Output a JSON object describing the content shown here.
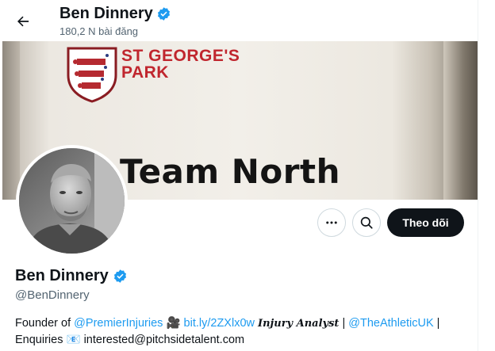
{
  "header": {
    "back_icon": "arrow-left-icon",
    "name": "Ben Dinnery",
    "posts_count": "180,2 N bài đăng"
  },
  "banner": {
    "sign_line1": "ST GEORGE'S",
    "sign_line2": "PARK",
    "sign_main": "Team North"
  },
  "actions": {
    "more_icon": "more-dots-icon",
    "search_icon": "search-icon",
    "follow_label": "Theo dõi"
  },
  "profile": {
    "name": "Ben Dinnery",
    "handle": "@BenDinnery",
    "verified_icon": "verified-badge-icon",
    "bio": {
      "line1": {
        "prefix": "Founder of ",
        "mention1": "@PremierInjuries",
        "emoji1": "🎥",
        "url": "bit.ly/2ZXlx0w",
        "role": "Injury Analyst",
        "separator": " | ",
        "mention2": "@TheAthleticUK",
        "suffix": " |"
      },
      "line2": {
        "prefix": "Enquiries ",
        "emoji": "📧",
        "email": " interested@pitchsidetalent.com"
      }
    }
  },
  "colors": {
    "accent": "#1d9bf0",
    "follow_bg": "#0f1419",
    "muted": "#536471"
  }
}
